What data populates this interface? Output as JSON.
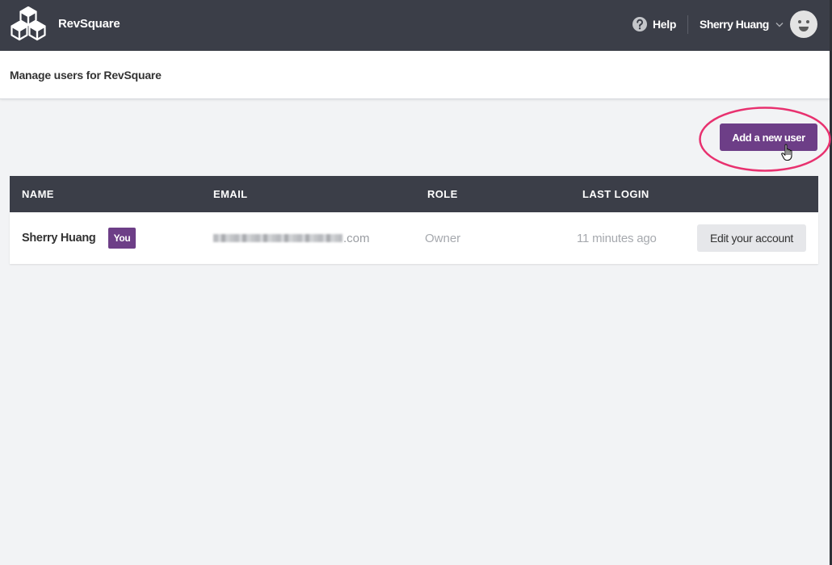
{
  "app": {
    "name": "RevSquare",
    "logo_icon": "cubes-logo-icon"
  },
  "topnav": {
    "help_icon": "question-circle-icon",
    "help_label": "Help",
    "user_name": "Sherry Huang",
    "user_menu_icon": "chevron-down-icon",
    "avatar_icon": "smiley-avatar-icon"
  },
  "page": {
    "title": "Manage users for RevSquare"
  },
  "actions": {
    "add_user_label": "Add a new user"
  },
  "table": {
    "columns": [
      "NAME",
      "EMAIL",
      "ROLE",
      "LAST LOGIN"
    ],
    "rows": [
      {
        "name": "Sherry Huang",
        "badge": "You",
        "email_suffix": ".com",
        "role": "Owner",
        "last_login": "11 minutes ago",
        "action_label": "Edit your account"
      }
    ]
  },
  "cursor_icon": "hand-pointer-icon",
  "colors": {
    "nav": "#3b3e48",
    "accent": "#6d3e87",
    "annotation": "#e8316f",
    "page_bg": "#f2f3f5"
  }
}
